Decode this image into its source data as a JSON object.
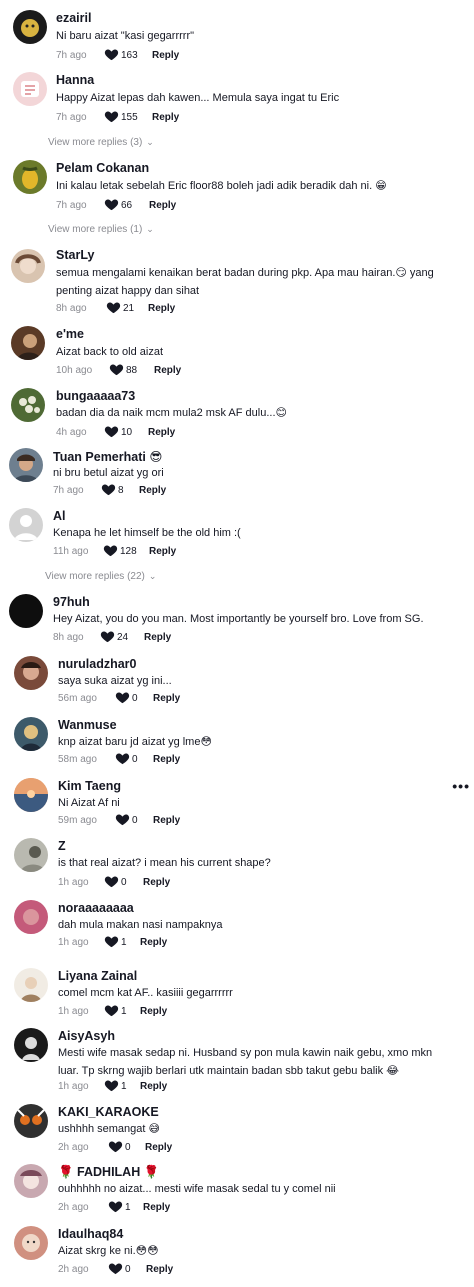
{
  "comments": [
    {
      "user": "ezairil",
      "text": "Ni baru aizat \"kasi gegarrrrr\"",
      "time": "7h ago",
      "likes": "163",
      "reply": "Reply",
      "avatar_color": "#1b1b1b",
      "avatar_accent": "#d8b340"
    },
    {
      "user": "Hanna",
      "text": "Happy Aizat lepas dah kawen... Memula saya ingat tu Eric",
      "time": "7h ago",
      "likes": "155",
      "reply": "Reply",
      "avatar_color": "#f3d6d8",
      "avatar_accent": "#c9474f"
    },
    {
      "user": "Pelam Cokanan",
      "text": "Ini kalau letak sebelah Eric floor88 boleh jadi adik beradik dah ni. 😁",
      "time": "7h ago",
      "likes": "66",
      "reply": "Reply",
      "avatar_color": "#6b7a2a",
      "avatar_accent": "#e2b62a"
    },
    {
      "user": "StarLy",
      "text": "semua mengalami kenaikan berat badan during pkp. Apa mau hairan.😏 yang penting aizat happy dan sihat",
      "time": "8h ago",
      "likes": "21",
      "reply": "Reply",
      "avatar_color": "#d9c4b0",
      "avatar_accent": "#6b4a36"
    },
    {
      "user": "e'me",
      "text": "Aizat back to old aizat",
      "time": "10h ago",
      "likes": "88",
      "reply": "Reply",
      "avatar_color": "#5a3a26",
      "avatar_accent": "#caa07a"
    },
    {
      "user": "bungaaaaa73",
      "text": "badan dia da naik mcm mula2 msk AF dulu...😊",
      "time": "4h ago",
      "likes": "10",
      "reply": "Reply",
      "avatar_color": "#4f6a35",
      "avatar_accent": "#e9e9d8"
    },
    {
      "user": "Tuan Pemerhati 😎",
      "text": "ni bru betul aizat yg ori",
      "time": "7h ago",
      "likes": "8",
      "reply": "Reply",
      "avatar_color": "#6e7f8f",
      "avatar_accent": "#3b2b22"
    },
    {
      "user": "Al",
      "text": "Kenapa he let himself be the old him :(",
      "time": "11h ago",
      "likes": "128",
      "reply": "Reply",
      "avatar_color": "#d3d3d3",
      "avatar_accent": "#ffffff"
    },
    {
      "user": "97huh",
      "text": "Hey Aizat, you do you man. Most importantly be yourself bro. Love from SG.",
      "time": "8h ago",
      "likes": "24",
      "reply": "Reply",
      "avatar_color": "#0e0e0e",
      "avatar_accent": "#222222"
    },
    {
      "user": "nuruladzhar0",
      "text": "saya suka aizat yg ini...",
      "time": "56m ago",
      "likes": "0",
      "reply": "Reply",
      "avatar_color": "#7a4a3a",
      "avatar_accent": "#2a1a14"
    },
    {
      "user": "Wanmuse",
      "text": "knp aizat baru jd aizat yg lme😳",
      "time": "58m ago",
      "likes": "0",
      "reply": "Reply",
      "avatar_color": "#3d5a6a",
      "avatar_accent": "#e0c080"
    },
    {
      "user": "Kim Taeng",
      "text": "Ni Aizat Af ni",
      "time": "59m ago",
      "likes": "0",
      "reply": "Reply",
      "avatar_color": "#d58a5a",
      "avatar_accent": "#3c5a80"
    },
    {
      "user": "Z",
      "text": "is that real aizat? i mean his current shape?",
      "time": "1h ago",
      "likes": "0",
      "reply": "Reply",
      "avatar_color": "#b9b9b0",
      "avatar_accent": "#5a5a50"
    },
    {
      "user": "noraaaaaaaa",
      "text": "dah mula makan nasi nampaknya",
      "time": "1h ago",
      "likes": "1",
      "reply": "Reply",
      "avatar_color": "#c45a7a",
      "avatar_accent": "#f0d0c0"
    },
    {
      "user": "Liyana Zainal",
      "text": "comel mcm kat AF.. kasiiii gegarrrrrr",
      "time": "1h ago",
      "likes": "1",
      "reply": "Reply",
      "avatar_color": "#f1ece4",
      "avatar_accent": "#a08060"
    },
    {
      "user": "AisyAsyh",
      "text": "Mesti wife masak sedap ni. Husband sy pon mula kawin naik gebu, xmo mkn luar. Tp skrng wajib berlari utk maintain badan sbb takut gebu balik 😂",
      "time": "1h ago",
      "likes": "1",
      "reply": "Reply",
      "avatar_color": "#1a1a1a",
      "avatar_accent": "#dcdcdc"
    },
    {
      "user": "KAKI_KARAOKE",
      "text": "ushhhh semangat 😅",
      "time": "2h ago",
      "likes": "0",
      "reply": "Reply",
      "avatar_color": "#303030",
      "avatar_accent": "#e07020"
    },
    {
      "user": "🌹 FADHILAH 🌹",
      "text": "ouhhhhh no aizat... mesti wife masak sedal tu y comel nii",
      "time": "2h ago",
      "likes": "1",
      "reply": "Reply",
      "avatar_color": "#c8a8b0",
      "avatar_accent": "#f4e4e0"
    },
    {
      "user": "Idaulhaq84",
      "text": "Aizat skrg ke ni.😳😳",
      "time": "2h ago",
      "likes": "0",
      "reply": "Reply",
      "avatar_color": "#d09080",
      "avatar_accent": "#f0d8c8"
    }
  ],
  "view_more": [
    {
      "label": "View more replies (3)"
    },
    {
      "label": "View more replies (1)"
    },
    {
      "label": "View more replies (22)"
    }
  ],
  "more_options": "•••"
}
